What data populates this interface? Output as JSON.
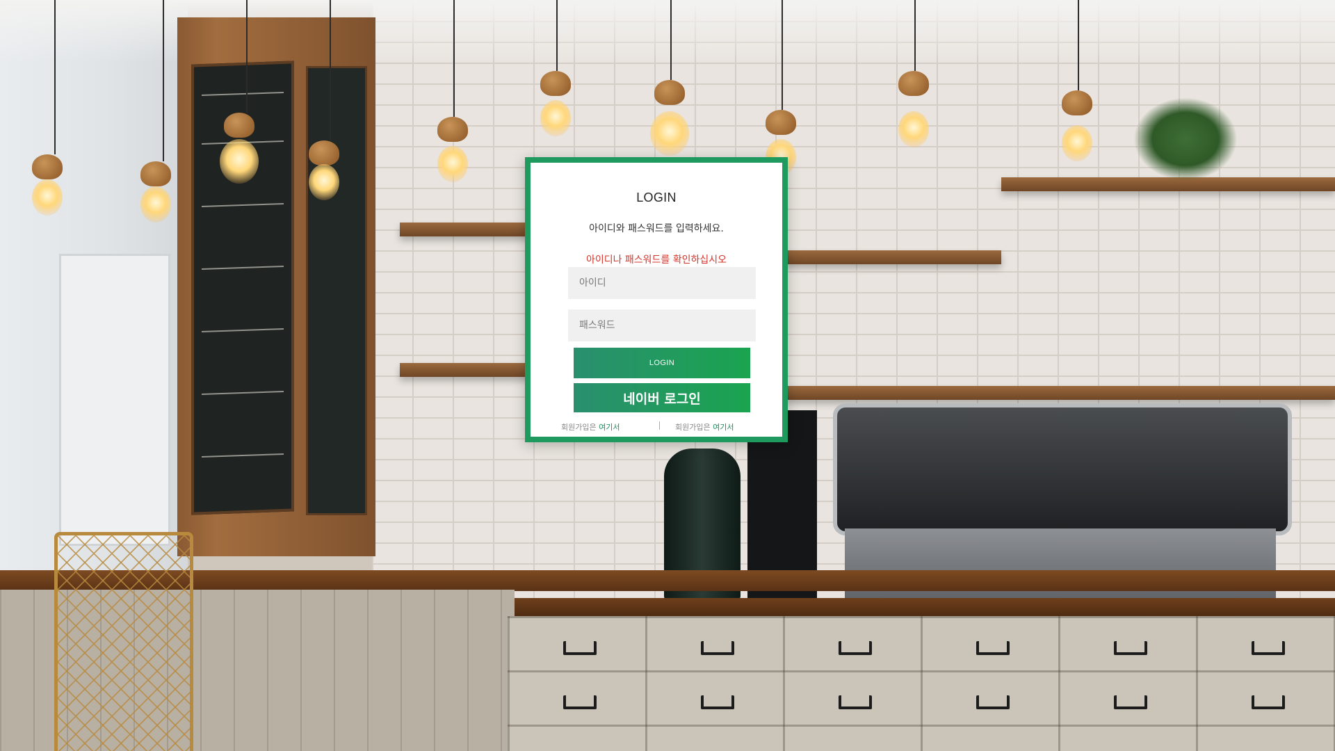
{
  "login": {
    "title": "LOGIN",
    "subtitle": "아이디와 패스워드를 입력하세요.",
    "error_message": "아이디나 패스워드를 확인하십시오",
    "id_placeholder": "아이디",
    "id_value": "",
    "password_placeholder": "패스워드",
    "password_value": "",
    "login_button": "LOGIN",
    "naver_button": "네이버 로그인",
    "signup_links": [
      {
        "prefix": "회원가입은 ",
        "link": "여기서"
      },
      {
        "prefix": "회원가입은 ",
        "link": "여기서"
      }
    ]
  },
  "colors": {
    "frame_green": "#1f9a5f",
    "button_gradient_start": "#2a8f6f",
    "button_gradient_end": "#1aa44f",
    "error_red": "#d4352b",
    "link_green": "#1f8a5a"
  },
  "background": {
    "description_icon": "cafe-interior-photo"
  }
}
